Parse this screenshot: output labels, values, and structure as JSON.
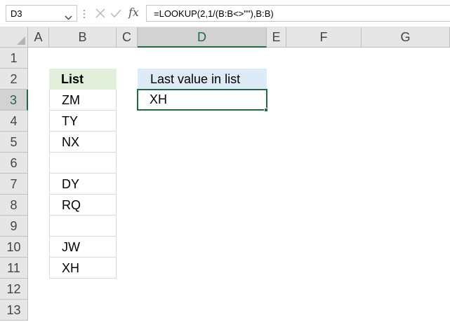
{
  "formula_bar": {
    "name_box": "D3",
    "fx_label": "fx",
    "formula": "=LOOKUP(2,1/(B:B<>\"\"),B:B)"
  },
  "columns": [
    "A",
    "B",
    "C",
    "D",
    "E",
    "F",
    "G"
  ],
  "active_column": "D",
  "rows": [
    "1",
    "2",
    "3",
    "4",
    "5",
    "6",
    "7",
    "8",
    "9",
    "10",
    "11",
    "12",
    "13"
  ],
  "active_row": "3",
  "list": {
    "header": "List",
    "values": [
      "ZM",
      "TY",
      "NX",
      "",
      "DY",
      "RQ",
      "",
      "JW",
      "XH"
    ]
  },
  "result": {
    "header": "Last value in list",
    "value": "XH"
  },
  "colors": {
    "accent": "#1e6c41",
    "list_header_fill": "#e2efda",
    "result_header_fill": "#ddebf7"
  },
  "icons": [
    "chevron-down-icon",
    "cancel-icon",
    "enter-icon",
    "fx-icon"
  ]
}
